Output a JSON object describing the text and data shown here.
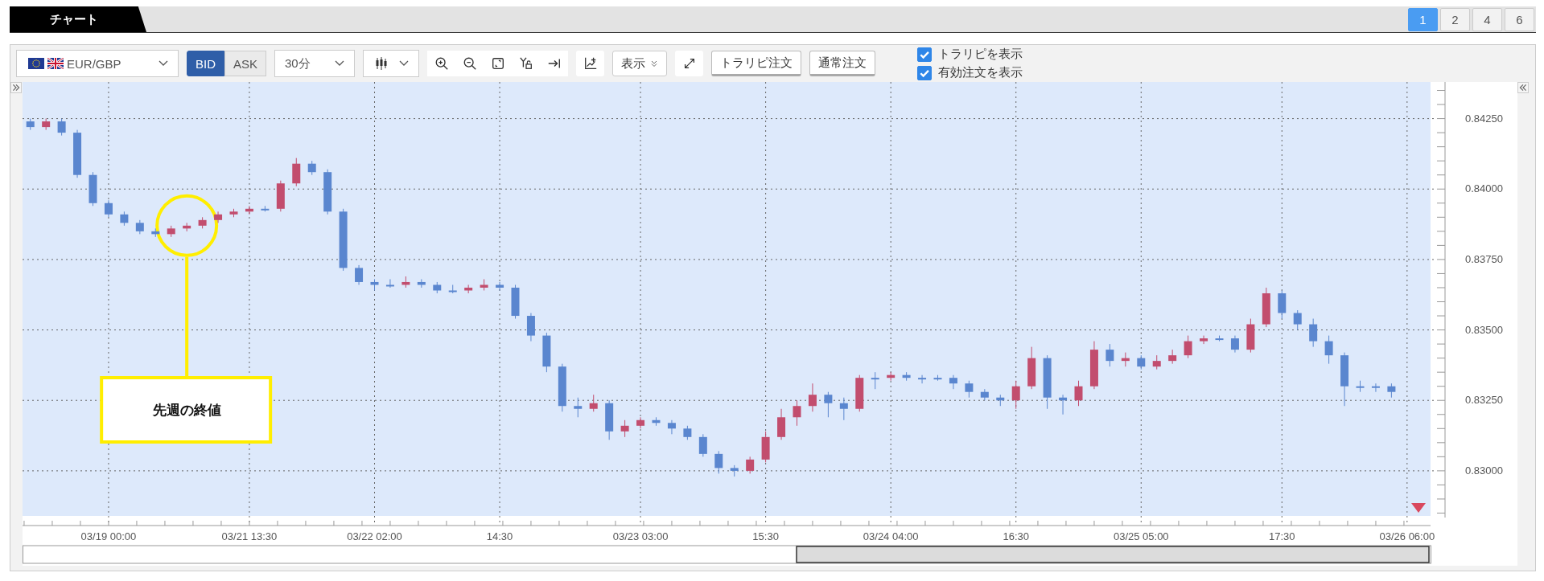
{
  "tab": {
    "label": "チャート"
  },
  "layouts": [
    {
      "label": "1",
      "selected": true
    },
    {
      "label": "2",
      "selected": false
    },
    {
      "label": "4",
      "selected": false
    },
    {
      "label": "6",
      "selected": false
    }
  ],
  "toolbar": {
    "pair": "EUR/GBP",
    "price_sides": [
      {
        "label": "BID",
        "selected": true
      },
      {
        "label": "ASK",
        "selected": false
      }
    ],
    "timeframe": "30分",
    "display_menu": "表示",
    "buttons": [
      "トラリピ注文",
      "通常注文"
    ],
    "toggles": [
      {
        "label": "トラリピを表示",
        "checked": true
      },
      {
        "label": "有効注文を表示",
        "checked": true
      }
    ]
  },
  "chart": {
    "chart_data": {
      "type": "candlestick",
      "grid": true,
      "categories": [
        null,
        null,
        null,
        null,
        null,
        "03/19 00:00",
        null,
        null,
        null,
        null,
        null,
        null,
        null,
        null,
        "03/21 13:30",
        null,
        null,
        null,
        null,
        null,
        null,
        null,
        "03/22 02:00",
        null,
        null,
        null,
        null,
        null,
        null,
        null,
        "14:30",
        null,
        null,
        null,
        null,
        null,
        null,
        null,
        null,
        "03/23 03:00",
        null,
        null,
        null,
        null,
        null,
        null,
        null,
        "15:30",
        null,
        null,
        null,
        null,
        null,
        null,
        null,
        "03/24 04:00",
        null,
        null,
        null,
        null,
        null,
        null,
        null,
        "16:30",
        null,
        null,
        null,
        null,
        null,
        null,
        null,
        "03/25 05:00",
        null,
        null,
        null,
        null,
        null,
        null,
        null,
        null,
        "17:30",
        null,
        null,
        null,
        null,
        null,
        null,
        null,
        "03/26 06:00",
        null
      ],
      "ohlc": [
        [
          0.8424,
          0.8425,
          0.8421,
          0.8422
        ],
        [
          0.8422,
          0.8425,
          0.8421,
          0.8424
        ],
        [
          0.8424,
          0.8425,
          0.8419,
          0.842
        ],
        [
          0.842,
          0.8421,
          0.8404,
          0.8405
        ],
        [
          0.8405,
          0.8406,
          0.8394,
          0.8395
        ],
        [
          0.8395,
          0.8396,
          0.839,
          0.8391
        ],
        [
          0.8391,
          0.8392,
          0.8387,
          0.8388
        ],
        [
          0.8388,
          0.8389,
          0.8384,
          0.8385
        ],
        [
          0.8385,
          0.8386,
          0.8383,
          0.8384
        ],
        [
          0.8384,
          0.8387,
          0.8383,
          0.8386
        ],
        [
          0.8386,
          0.8388,
          0.8385,
          0.8387
        ],
        [
          0.8387,
          0.839,
          0.8386,
          0.8389
        ],
        [
          0.8389,
          0.8392,
          0.8388,
          0.8391
        ],
        [
          0.8391,
          0.8393,
          0.839,
          0.8392
        ],
        [
          0.8392,
          0.8394,
          0.8391,
          0.8393
        ],
        [
          0.8393,
          0.8394,
          0.8392,
          0.8393
        ],
        [
          0.8393,
          0.8403,
          0.8392,
          0.8402
        ],
        [
          0.8402,
          0.8411,
          0.8401,
          0.8409
        ],
        [
          0.8409,
          0.841,
          0.8405,
          0.8406
        ],
        [
          0.8406,
          0.8407,
          0.8391,
          0.8392
        ],
        [
          0.8392,
          0.8393,
          0.8371,
          0.8372
        ],
        [
          0.8372,
          0.8373,
          0.8366,
          0.8367
        ],
        [
          0.8367,
          0.8368,
          0.8364,
          0.8366
        ],
        [
          0.8366,
          0.8368,
          0.8365,
          0.8366
        ],
        [
          0.8366,
          0.8369,
          0.8365,
          0.8367
        ],
        [
          0.8367,
          0.8368,
          0.8365,
          0.8366
        ],
        [
          0.8366,
          0.8367,
          0.8363,
          0.8364
        ],
        [
          0.8364,
          0.8366,
          0.8363,
          0.8364
        ],
        [
          0.8364,
          0.8366,
          0.8363,
          0.8365
        ],
        [
          0.8365,
          0.8368,
          0.8364,
          0.8366
        ],
        [
          0.8366,
          0.8367,
          0.8364,
          0.8365
        ],
        [
          0.8365,
          0.8366,
          0.8354,
          0.8355
        ],
        [
          0.8355,
          0.8356,
          0.8346,
          0.8348
        ],
        [
          0.8348,
          0.8349,
          0.8335,
          0.8337
        ],
        [
          0.8337,
          0.8338,
          0.8321,
          0.8323
        ],
        [
          0.8323,
          0.8326,
          0.8319,
          0.8322
        ],
        [
          0.8322,
          0.8327,
          0.8321,
          0.8324
        ],
        [
          0.8324,
          0.8325,
          0.8311,
          0.8314
        ],
        [
          0.8314,
          0.8318,
          0.8312,
          0.8316
        ],
        [
          0.8316,
          0.8319,
          0.8315,
          0.8318
        ],
        [
          0.8318,
          0.8319,
          0.8316,
          0.8317
        ],
        [
          0.8317,
          0.8318,
          0.8313,
          0.8315
        ],
        [
          0.8315,
          0.8316,
          0.8311,
          0.8312
        ],
        [
          0.8312,
          0.8313,
          0.8305,
          0.8306
        ],
        [
          0.8306,
          0.8307,
          0.8299,
          0.8301
        ],
        [
          0.8301,
          0.8302,
          0.8298,
          0.83
        ],
        [
          0.83,
          0.8305,
          0.8299,
          0.8304
        ],
        [
          0.8304,
          0.8314,
          0.8303,
          0.8312
        ],
        [
          0.8312,
          0.8322,
          0.8311,
          0.8319
        ],
        [
          0.8319,
          0.8325,
          0.8316,
          0.8323
        ],
        [
          0.8323,
          0.8331,
          0.8321,
          0.8327
        ],
        [
          0.8327,
          0.8328,
          0.8319,
          0.8324
        ],
        [
          0.8324,
          0.8326,
          0.8318,
          0.8322
        ],
        [
          0.8322,
          0.8334,
          0.8321,
          0.8333
        ],
        [
          0.8333,
          0.8335,
          0.8329,
          0.8333
        ],
        [
          0.8333,
          0.8335,
          0.8332,
          0.8334
        ],
        [
          0.8334,
          0.8335,
          0.8332,
          0.8333
        ],
        [
          0.8333,
          0.8334,
          0.8331,
          0.8333
        ],
        [
          0.8333,
          0.8334,
          0.8332,
          0.8333
        ],
        [
          0.8333,
          0.8334,
          0.8329,
          0.8331
        ],
        [
          0.8331,
          0.8332,
          0.8326,
          0.8328
        ],
        [
          0.8328,
          0.8329,
          0.8325,
          0.8326
        ],
        [
          0.8326,
          0.8327,
          0.8323,
          0.8325
        ],
        [
          0.8325,
          0.8332,
          0.8322,
          0.833
        ],
        [
          0.833,
          0.8344,
          0.8329,
          0.834
        ],
        [
          0.834,
          0.8341,
          0.8322,
          0.8326
        ],
        [
          0.8326,
          0.8327,
          0.832,
          0.8325
        ],
        [
          0.8325,
          0.8332,
          0.8323,
          0.833
        ],
        [
          0.833,
          0.8346,
          0.8329,
          0.8343
        ],
        [
          0.8343,
          0.8345,
          0.8337,
          0.8339
        ],
        [
          0.8339,
          0.8342,
          0.8337,
          0.834
        ],
        [
          0.834,
          0.8341,
          0.8336,
          0.8337
        ],
        [
          0.8337,
          0.8341,
          0.8336,
          0.8339
        ],
        [
          0.8339,
          0.8343,
          0.8338,
          0.8341
        ],
        [
          0.8341,
          0.8348,
          0.834,
          0.8346
        ],
        [
          0.8346,
          0.8348,
          0.8345,
          0.8347
        ],
        [
          0.8347,
          0.8348,
          0.8346,
          0.8347
        ],
        [
          0.8347,
          0.8348,
          0.8342,
          0.8343
        ],
        [
          0.8343,
          0.8354,
          0.8342,
          0.8352
        ],
        [
          0.8352,
          0.8365,
          0.8351,
          0.8363
        ],
        [
          0.8363,
          0.8364,
          0.8354,
          0.8356
        ],
        [
          0.8356,
          0.8357,
          0.835,
          0.8352
        ],
        [
          0.8352,
          0.8354,
          0.8344,
          0.8346
        ],
        [
          0.8346,
          0.8348,
          0.8338,
          0.8341
        ],
        [
          0.8341,
          0.8342,
          0.8323,
          0.833
        ],
        [
          0.833,
          0.8332,
          0.8328,
          0.833
        ],
        [
          0.833,
          0.8331,
          0.8328,
          0.833
        ],
        [
          0.833,
          0.8331,
          0.8326,
          0.8328
        ],
        null,
        null
      ],
      "ylim": [
        0.8284,
        0.8438
      ],
      "yticks": [
        {
          "value": 0.83,
          "label": "0.83000"
        },
        {
          "value": 0.8325,
          "label": "0.83250"
        },
        {
          "value": 0.835,
          "label": "0.83500"
        },
        {
          "value": 0.8375,
          "label": "0.83750"
        },
        {
          "value": 0.84,
          "label": "0.84000"
        },
        {
          "value": 0.8425,
          "label": "0.84250"
        }
      ],
      "annotations": [
        {
          "text": "先週の終値"
        }
      ]
    }
  }
}
